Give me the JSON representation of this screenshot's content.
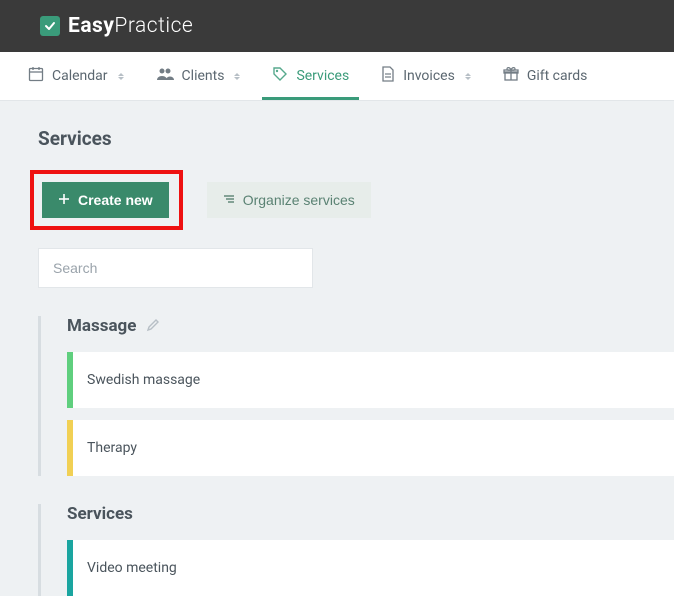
{
  "brand": {
    "bold": "Easy",
    "light": "Practice"
  },
  "nav": {
    "calendar": "Calendar",
    "clients": "Clients",
    "services": "Services",
    "invoices": "Invoices",
    "giftcards": "Gift cards"
  },
  "page": {
    "title": "Services",
    "create_label": "Create new",
    "organize_label": "Organize services",
    "search_placeholder": "Search"
  },
  "categories": [
    {
      "name": "Massage",
      "items": [
        {
          "name": "Swedish massage",
          "color": "green"
        },
        {
          "name": "Therapy",
          "color": "yellow"
        }
      ]
    },
    {
      "name": "Services",
      "items": [
        {
          "name": "Video meeting",
          "color": "teal"
        }
      ]
    }
  ]
}
